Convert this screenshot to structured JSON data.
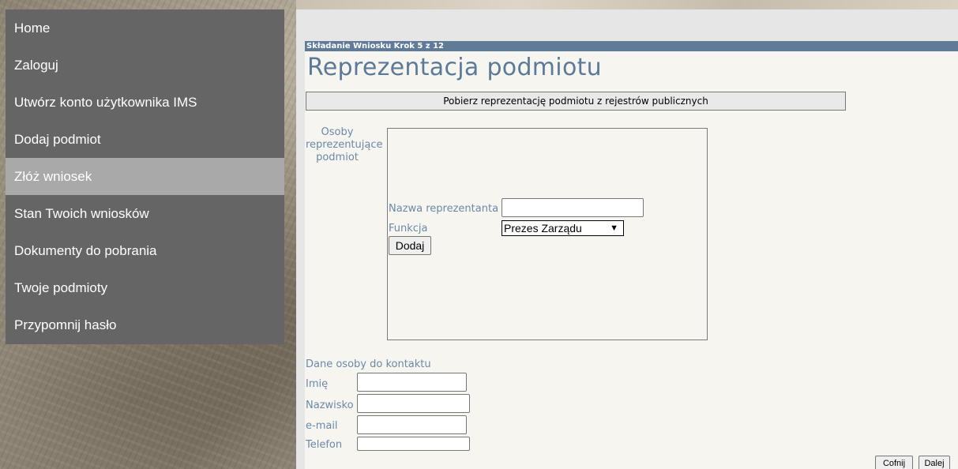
{
  "nav": {
    "items": [
      {
        "label": "Home"
      },
      {
        "label": "Zaloguj"
      },
      {
        "label": "Utwórz konto użytkownika IMS"
      },
      {
        "label": "Dodaj podmiot"
      },
      {
        "label": "Złóż wniosek",
        "active": true
      },
      {
        "label": "Stan Twoich wniosków"
      },
      {
        "label": "Dokumenty do pobrania"
      },
      {
        "label": "Twoje podmioty"
      },
      {
        "label": "Przypomnij hasło"
      }
    ]
  },
  "main": {
    "step_label": "Składanie Wniosku Krok 5 z 12",
    "title": "Reprezentacja podmiotu",
    "fetch_button": "Pobierz reprezentację podmiotu z rejestrów publicznych"
  },
  "representatives": {
    "section_label": "Osoby reprezentujące podmiot",
    "name_label": "Nazwa reprezentanta",
    "name_value": "",
    "function_label": "Funkcja",
    "function_selected": "Prezes Zarządu",
    "add_button": "Dodaj"
  },
  "contact": {
    "section_label": "Dane osoby do kontaktu",
    "first_name_label": "Imię",
    "last_name_label": "Nazwisko",
    "email_label": "e-mail",
    "phone_label": "Telefon",
    "first_name_value": "",
    "last_name_value": "",
    "email_value": "",
    "phone_value": ""
  },
  "footer": {
    "back_button": "Cofnij",
    "next_button": "Dalej"
  },
  "colors": {
    "sidebar": "#666565",
    "sidebar_active": "#a9a9a9",
    "step_bar": "#5f7b98",
    "title": "#5b7a99",
    "label": "#6a89a8"
  }
}
